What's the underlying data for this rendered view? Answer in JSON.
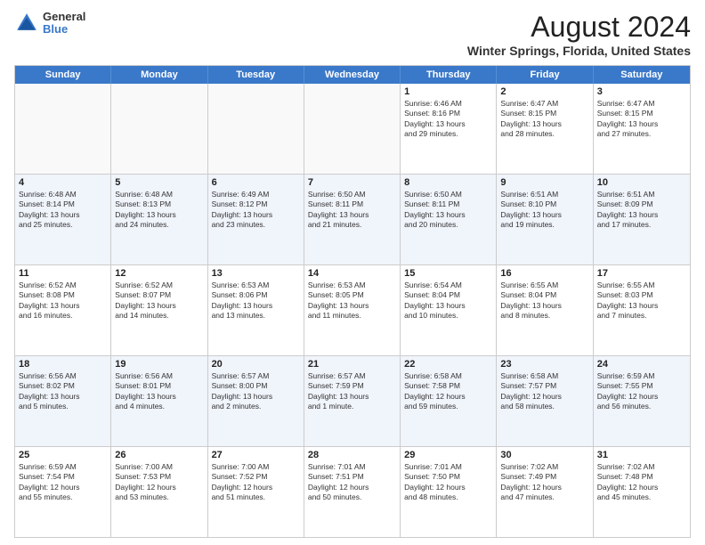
{
  "logo": {
    "general": "General",
    "blue": "Blue"
  },
  "title": "August 2024",
  "location": "Winter Springs, Florida, United States",
  "weekdays": [
    "Sunday",
    "Monday",
    "Tuesday",
    "Wednesday",
    "Thursday",
    "Friday",
    "Saturday"
  ],
  "rows": [
    {
      "alt": false,
      "cells": [
        {
          "empty": true,
          "day": "",
          "info": ""
        },
        {
          "empty": true,
          "day": "",
          "info": ""
        },
        {
          "empty": true,
          "day": "",
          "info": ""
        },
        {
          "empty": true,
          "day": "",
          "info": ""
        },
        {
          "empty": false,
          "day": "1",
          "info": "Sunrise: 6:46 AM\nSunset: 8:16 PM\nDaylight: 13 hours\nand 29 minutes."
        },
        {
          "empty": false,
          "day": "2",
          "info": "Sunrise: 6:47 AM\nSunset: 8:15 PM\nDaylight: 13 hours\nand 28 minutes."
        },
        {
          "empty": false,
          "day": "3",
          "info": "Sunrise: 6:47 AM\nSunset: 8:15 PM\nDaylight: 13 hours\nand 27 minutes."
        }
      ]
    },
    {
      "alt": true,
      "cells": [
        {
          "empty": false,
          "day": "4",
          "info": "Sunrise: 6:48 AM\nSunset: 8:14 PM\nDaylight: 13 hours\nand 25 minutes."
        },
        {
          "empty": false,
          "day": "5",
          "info": "Sunrise: 6:48 AM\nSunset: 8:13 PM\nDaylight: 13 hours\nand 24 minutes."
        },
        {
          "empty": false,
          "day": "6",
          "info": "Sunrise: 6:49 AM\nSunset: 8:12 PM\nDaylight: 13 hours\nand 23 minutes."
        },
        {
          "empty": false,
          "day": "7",
          "info": "Sunrise: 6:50 AM\nSunset: 8:11 PM\nDaylight: 13 hours\nand 21 minutes."
        },
        {
          "empty": false,
          "day": "8",
          "info": "Sunrise: 6:50 AM\nSunset: 8:11 PM\nDaylight: 13 hours\nand 20 minutes."
        },
        {
          "empty": false,
          "day": "9",
          "info": "Sunrise: 6:51 AM\nSunset: 8:10 PM\nDaylight: 13 hours\nand 19 minutes."
        },
        {
          "empty": false,
          "day": "10",
          "info": "Sunrise: 6:51 AM\nSunset: 8:09 PM\nDaylight: 13 hours\nand 17 minutes."
        }
      ]
    },
    {
      "alt": false,
      "cells": [
        {
          "empty": false,
          "day": "11",
          "info": "Sunrise: 6:52 AM\nSunset: 8:08 PM\nDaylight: 13 hours\nand 16 minutes."
        },
        {
          "empty": false,
          "day": "12",
          "info": "Sunrise: 6:52 AM\nSunset: 8:07 PM\nDaylight: 13 hours\nand 14 minutes."
        },
        {
          "empty": false,
          "day": "13",
          "info": "Sunrise: 6:53 AM\nSunset: 8:06 PM\nDaylight: 13 hours\nand 13 minutes."
        },
        {
          "empty": false,
          "day": "14",
          "info": "Sunrise: 6:53 AM\nSunset: 8:05 PM\nDaylight: 13 hours\nand 11 minutes."
        },
        {
          "empty": false,
          "day": "15",
          "info": "Sunrise: 6:54 AM\nSunset: 8:04 PM\nDaylight: 13 hours\nand 10 minutes."
        },
        {
          "empty": false,
          "day": "16",
          "info": "Sunrise: 6:55 AM\nSunset: 8:04 PM\nDaylight: 13 hours\nand 8 minutes."
        },
        {
          "empty": false,
          "day": "17",
          "info": "Sunrise: 6:55 AM\nSunset: 8:03 PM\nDaylight: 13 hours\nand 7 minutes."
        }
      ]
    },
    {
      "alt": true,
      "cells": [
        {
          "empty": false,
          "day": "18",
          "info": "Sunrise: 6:56 AM\nSunset: 8:02 PM\nDaylight: 13 hours\nand 5 minutes."
        },
        {
          "empty": false,
          "day": "19",
          "info": "Sunrise: 6:56 AM\nSunset: 8:01 PM\nDaylight: 13 hours\nand 4 minutes."
        },
        {
          "empty": false,
          "day": "20",
          "info": "Sunrise: 6:57 AM\nSunset: 8:00 PM\nDaylight: 13 hours\nand 2 minutes."
        },
        {
          "empty": false,
          "day": "21",
          "info": "Sunrise: 6:57 AM\nSunset: 7:59 PM\nDaylight: 13 hours\nand 1 minute."
        },
        {
          "empty": false,
          "day": "22",
          "info": "Sunrise: 6:58 AM\nSunset: 7:58 PM\nDaylight: 12 hours\nand 59 minutes."
        },
        {
          "empty": false,
          "day": "23",
          "info": "Sunrise: 6:58 AM\nSunset: 7:57 PM\nDaylight: 12 hours\nand 58 minutes."
        },
        {
          "empty": false,
          "day": "24",
          "info": "Sunrise: 6:59 AM\nSunset: 7:55 PM\nDaylight: 12 hours\nand 56 minutes."
        }
      ]
    },
    {
      "alt": false,
      "cells": [
        {
          "empty": false,
          "day": "25",
          "info": "Sunrise: 6:59 AM\nSunset: 7:54 PM\nDaylight: 12 hours\nand 55 minutes."
        },
        {
          "empty": false,
          "day": "26",
          "info": "Sunrise: 7:00 AM\nSunset: 7:53 PM\nDaylight: 12 hours\nand 53 minutes."
        },
        {
          "empty": false,
          "day": "27",
          "info": "Sunrise: 7:00 AM\nSunset: 7:52 PM\nDaylight: 12 hours\nand 51 minutes."
        },
        {
          "empty": false,
          "day": "28",
          "info": "Sunrise: 7:01 AM\nSunset: 7:51 PM\nDaylight: 12 hours\nand 50 minutes."
        },
        {
          "empty": false,
          "day": "29",
          "info": "Sunrise: 7:01 AM\nSunset: 7:50 PM\nDaylight: 12 hours\nand 48 minutes."
        },
        {
          "empty": false,
          "day": "30",
          "info": "Sunrise: 7:02 AM\nSunset: 7:49 PM\nDaylight: 12 hours\nand 47 minutes."
        },
        {
          "empty": false,
          "day": "31",
          "info": "Sunrise: 7:02 AM\nSunset: 7:48 PM\nDaylight: 12 hours\nand 45 minutes."
        }
      ]
    }
  ]
}
